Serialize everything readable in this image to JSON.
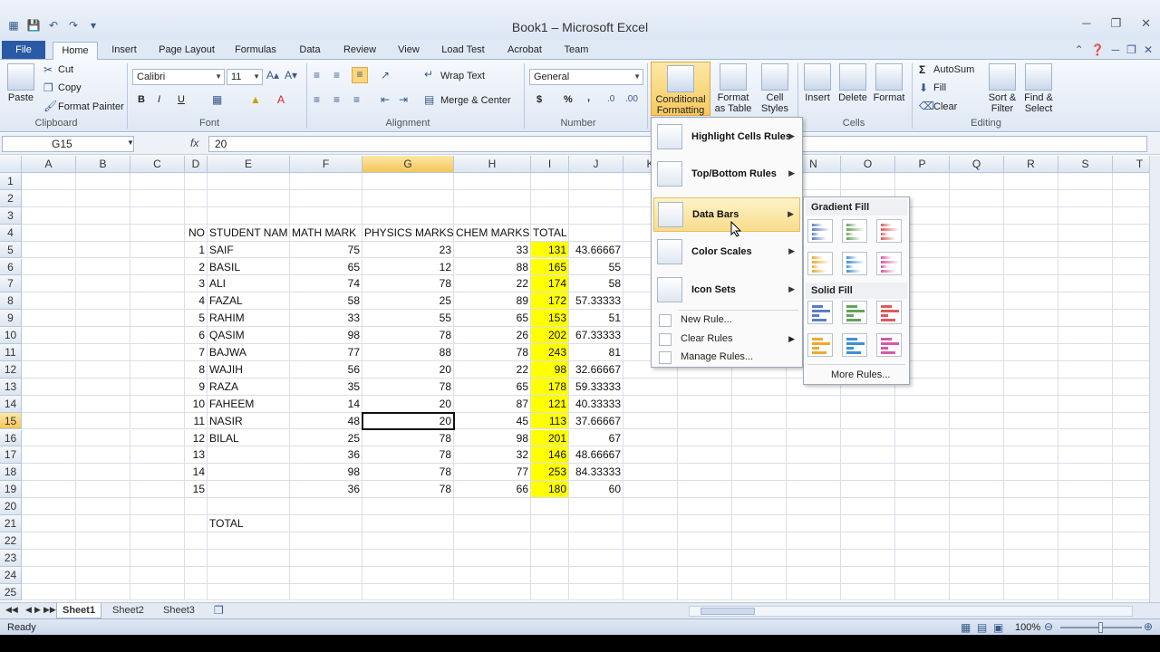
{
  "window": {
    "title": "Book1 – Microsoft Excel"
  },
  "tabs": [
    "File",
    "Home",
    "Insert",
    "Page Layout",
    "Formulas",
    "Data",
    "Review",
    "View",
    "Load Test",
    "Acrobat",
    "Team"
  ],
  "ribbon": {
    "clipboard": {
      "paste": "Paste",
      "cut": "Cut",
      "copy": "Copy",
      "format_painter": "Format Painter",
      "label": "Clipboard"
    },
    "font": {
      "name": "Calibri",
      "size": "11",
      "label": "Font",
      "bold": "B",
      "italic": "I",
      "underline": "U"
    },
    "alignment": {
      "wrap": "Wrap Text",
      "merge": "Merge & Center",
      "label": "Alignment"
    },
    "number": {
      "format": "General",
      "currency": "$",
      "percent": "%",
      "comma": ",",
      "label": "Number"
    },
    "styles": {
      "cf": "Conditional\nFormatting",
      "format_table": "Format\nas Table",
      "cell_styles": "Cell\nStyles"
    },
    "cells": {
      "insert": "Insert",
      "delete": "Delete",
      "format": "Format",
      "label": "Cells"
    },
    "editing": {
      "autosum": "AutoSum",
      "fill": "Fill",
      "clear": "Clear",
      "sort": "Sort &\nFilter",
      "find": "Find &\nSelect",
      "label": "Editing"
    }
  },
  "formula_bar": {
    "name_box": "G15",
    "fx": "fx",
    "value": "20"
  },
  "columns": [
    "A",
    "B",
    "C",
    "D",
    "E",
    "F",
    "G",
    "H",
    "I",
    "J",
    "K",
    "L",
    "M",
    "N",
    "O",
    "P",
    "Q",
    "R",
    "S",
    "T"
  ],
  "rows": [
    "1",
    "2",
    "3",
    "4",
    "5",
    "6",
    "7",
    "8",
    "9",
    "10",
    "11",
    "12",
    "13",
    "14",
    "15",
    "16",
    "17",
    "18",
    "19",
    "20",
    "21",
    "22",
    "23",
    "24",
    "25"
  ],
  "headers": {
    "no": "NO",
    "name": "STUDENT NAM",
    "math": "MATH MARK",
    "physics": "PHYSICS MARKS",
    "chem": "CHEM MARKS",
    "total": "TOTAL"
  },
  "table": [
    [
      "1",
      "SAIF",
      "75",
      "23",
      "33",
      "131",
      "43.66667"
    ],
    [
      "2",
      "BASIL",
      "65",
      "12",
      "88",
      "165",
      "55"
    ],
    [
      "3",
      "ALI",
      "74",
      "78",
      "22",
      "174",
      "58"
    ],
    [
      "4",
      "FAZAL",
      "58",
      "25",
      "89",
      "172",
      "57.33333"
    ],
    [
      "5",
      "RAHIM",
      "33",
      "55",
      "65",
      "153",
      "51"
    ],
    [
      "6",
      "QASIM",
      "98",
      "78",
      "26",
      "202",
      "67.33333"
    ],
    [
      "7",
      "BAJWA",
      "77",
      "88",
      "78",
      "243",
      "81"
    ],
    [
      "8",
      "WAJIH",
      "56",
      "20",
      "22",
      "98",
      "32.66667"
    ],
    [
      "9",
      "RAZA",
      "35",
      "78",
      "65",
      "178",
      "59.33333"
    ],
    [
      "10",
      "FAHEEM",
      "14",
      "20",
      "87",
      "121",
      "40.33333"
    ],
    [
      "11",
      "NASIR",
      "48",
      "20",
      "45",
      "113",
      "37.66667"
    ],
    [
      "12",
      "BILAL",
      "25",
      "78",
      "98",
      "201",
      "67"
    ],
    [
      "13",
      "",
      "36",
      "78",
      "32",
      "146",
      "48.66667"
    ],
    [
      "14",
      "",
      "98",
      "78",
      "77",
      "253",
      "84.33333"
    ],
    [
      "15",
      "",
      "36",
      "78",
      "66",
      "180",
      "60"
    ]
  ],
  "total_label": "TOTAL",
  "cf_menu": {
    "items": [
      "Highlight Cells Rules",
      "Top/Bottom Rules",
      "Data Bars",
      "Color Scales",
      "Icon Sets"
    ],
    "small_items": [
      "New Rule...",
      "Clear Rules",
      "Manage Rules..."
    ]
  },
  "databars_menu": {
    "gradient": "Gradient Fill",
    "solid": "Solid Fill",
    "more": "More Rules...",
    "colors": [
      "#5b7fc4",
      "#63a35c",
      "#e05a5a",
      "#f0a830",
      "#3f8fd6",
      "#d65aa8"
    ]
  },
  "sheets": [
    "Sheet1",
    "Sheet2",
    "Sheet3"
  ],
  "status": {
    "ready": "Ready",
    "zoom": "100%"
  }
}
